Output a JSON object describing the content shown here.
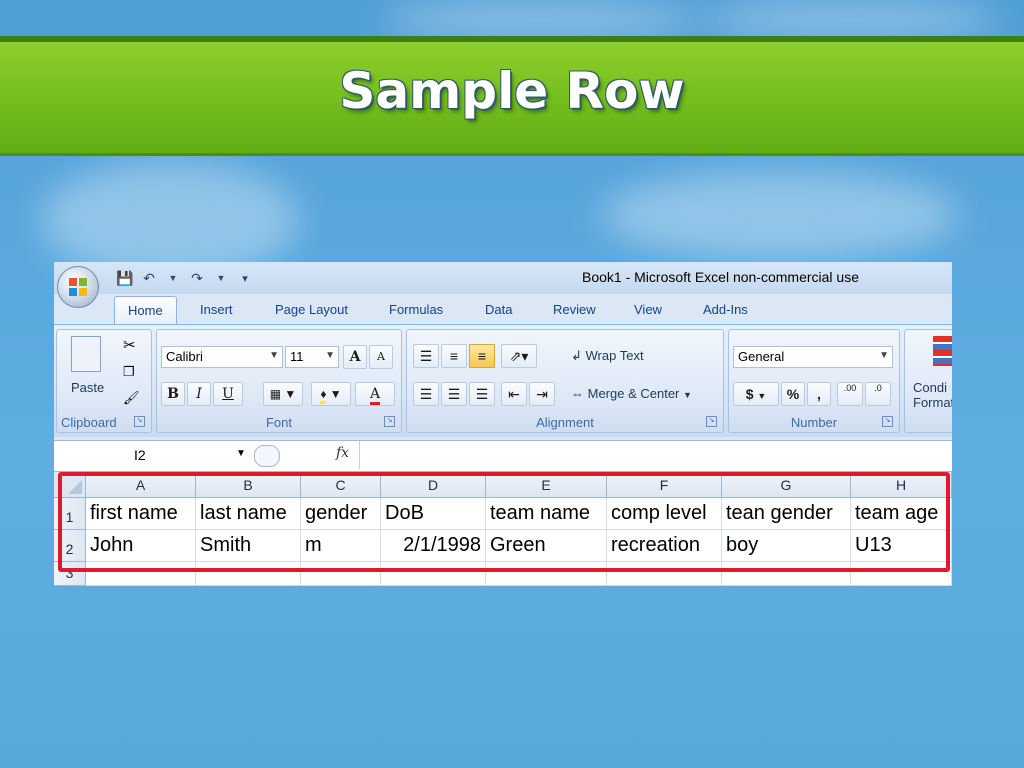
{
  "slide": {
    "title": "Sample Row"
  },
  "excel": {
    "window_title": "Book1 - Microsoft Excel non-commercial use",
    "tabs": [
      "Home",
      "Insert",
      "Page Layout",
      "Formulas",
      "Data",
      "Review",
      "View",
      "Add-Ins"
    ],
    "ribbon": {
      "clipboard": {
        "label": "Clipboard",
        "paste": "Paste"
      },
      "font": {
        "label": "Font",
        "name": "Calibri",
        "size": "11",
        "grow": "A",
        "shrink": "A",
        "bold": "B",
        "italic": "I",
        "underline": "U",
        "font_color": "A"
      },
      "alignment": {
        "label": "Alignment",
        "wrap_text": "Wrap Text",
        "merge_center": "Merge & Center"
      },
      "number": {
        "label": "Number",
        "format": "General",
        "currency": "$",
        "percent": "%",
        "comma": ",",
        "inc_decimal": ".00",
        "dec_decimal": ".0"
      },
      "styles": {
        "conditional": "Condi",
        "format": "Format"
      }
    },
    "formula_bar": {
      "name_box": "I2",
      "fx": "fx",
      "value": ""
    },
    "columns": [
      "A",
      "B",
      "C",
      "D",
      "E",
      "F",
      "G",
      "H"
    ],
    "rows": [
      {
        "num": "1",
        "cells": [
          "first name",
          "last name",
          "gender",
          "DoB",
          "team name",
          "comp level",
          "tean gender",
          "team age"
        ]
      },
      {
        "num": "2",
        "cells": [
          "John",
          "Smith",
          "m",
          "2/1/1998",
          "Green",
          "recreation",
          "boy",
          "U13"
        ]
      },
      {
        "num": "3",
        "cells": [
          "",
          "",
          "",
          "",
          "",
          "",
          "",
          ""
        ]
      }
    ]
  }
}
